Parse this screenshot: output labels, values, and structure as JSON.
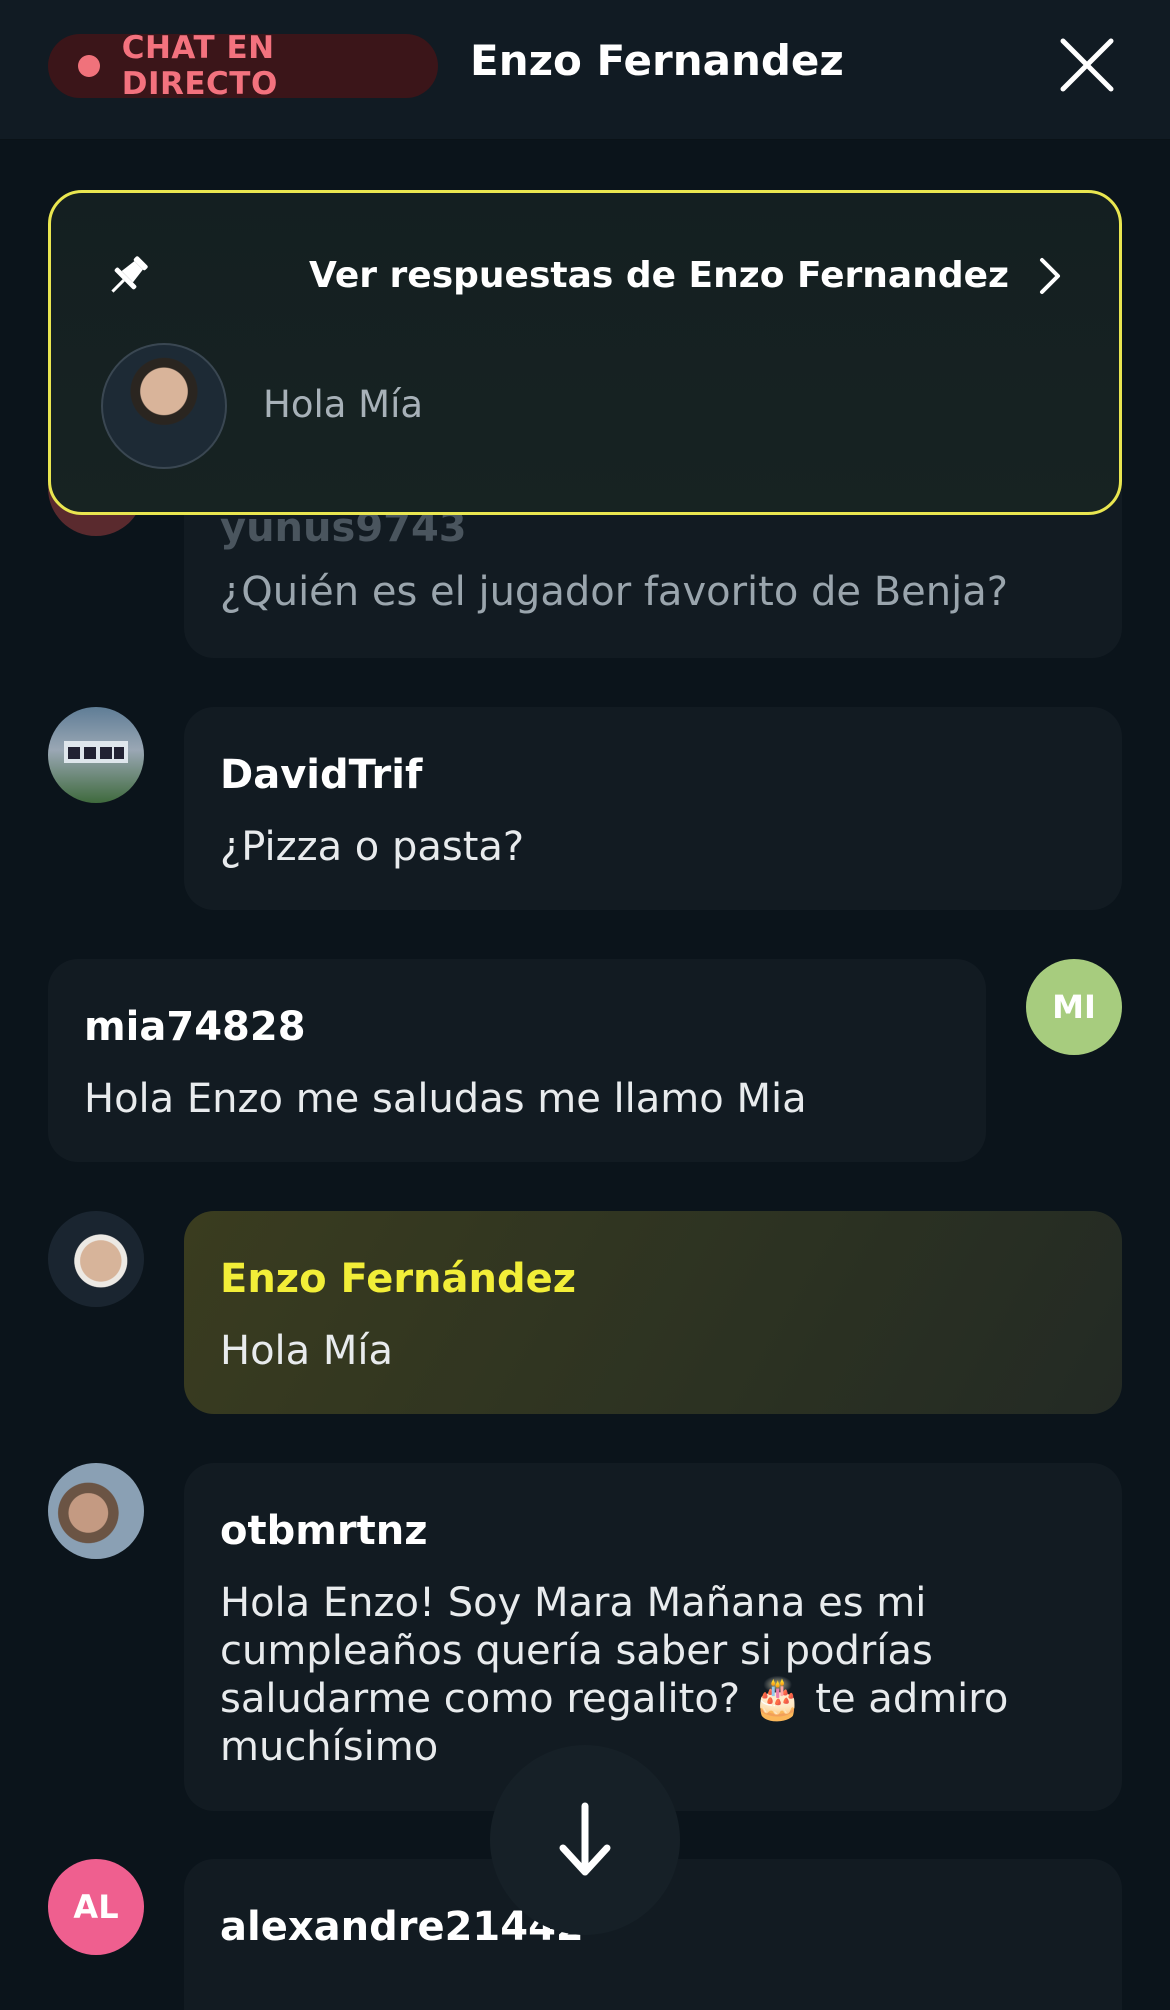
{
  "header": {
    "live_label": "CHAT EN DIRECTO",
    "title": "Enzo Fernandez",
    "close_icon": "close-icon"
  },
  "pinned": {
    "link_text": "Ver respuestas de Enzo Fernandez",
    "message": "Hola Mía",
    "border_color": "#e9e650"
  },
  "messages": [
    {
      "user": "yunus9743",
      "text": "¿Quién es el jugador favorito de Benja?"
    },
    {
      "user": "DavidTrif",
      "text": "¿Pizza o pasta?"
    },
    {
      "user": "mia74828",
      "text": "Hola Enzo me saludas me llamo Mia",
      "avatar_initials": "MI",
      "avatar_color": "#a7cc7e"
    },
    {
      "user": "Enzo Fernández",
      "text": "Hola Mía",
      "highlight_color": "#f2ee38"
    },
    {
      "user": "otbmrtnz",
      "text": "Hola Enzo! Soy Mara Mañana es mi cumpleaños quería saber si podrías saludarme como regalito? 🎂 te admiro muchísimo"
    },
    {
      "user": "alexandre21442",
      "avatar_initials": "AL",
      "avatar_color": "#ef5f8f"
    }
  ],
  "accent_colors": {
    "live": "#f3727e",
    "background": "#0b141b",
    "bubble": "#121b22"
  }
}
